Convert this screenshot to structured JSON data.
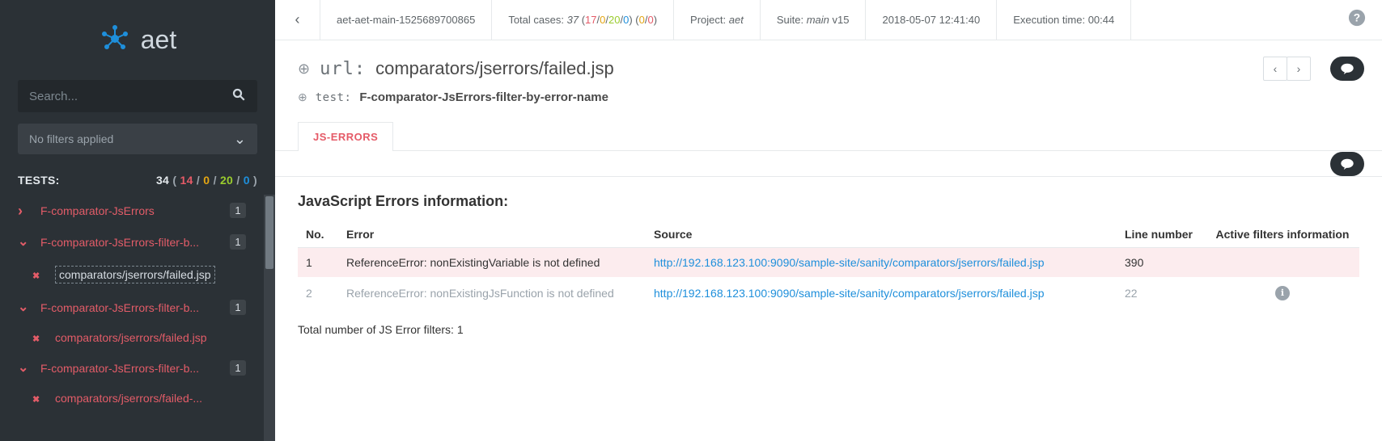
{
  "brand": {
    "name": "aet"
  },
  "sidebar": {
    "search_placeholder": "Search...",
    "filter_label": "No filters applied",
    "tests_label": "TESTS:",
    "tests_total": "34",
    "tests_fail": "14",
    "tests_warn": "0",
    "tests_pass": "20",
    "tests_skip": "0"
  },
  "test_items": [
    {
      "label": "F-comparator-JsErrors",
      "badge": "1",
      "expanded": false
    },
    {
      "label": "F-comparator-JsErrors-filter-b...",
      "badge": "1",
      "expanded": true,
      "child_label": "comparators/jserrors/failed.jsp",
      "child_selected": true
    },
    {
      "label": "F-comparator-JsErrors-filter-b...",
      "badge": "1",
      "expanded": true,
      "child_label": "comparators/jserrors/failed.jsp",
      "child_selected": false
    },
    {
      "label": "F-comparator-JsErrors-filter-b...",
      "badge": "1",
      "expanded": true,
      "child_label": "comparators/jserrors/failed-...",
      "child_selected": false
    }
  ],
  "topbar": {
    "run_name": "aet-aet-main-1525689700865",
    "total_label": "Total cases:",
    "total_val": "37",
    "total_fail": "17",
    "total_warn": "0",
    "total_pass": "20",
    "total_skip": "0",
    "total_extra_a": "0",
    "total_extra_b": "0",
    "project_label": "Project:",
    "project_val": "aet",
    "suite_label": "Suite:",
    "suite_val": "main",
    "suite_ver": "v15",
    "datetime": "2018-05-07 12:41:40",
    "exec_label": "Execution time:",
    "exec_val": "00:44"
  },
  "header": {
    "url_label": "url:",
    "url_value": "comparators/jserrors/failed.jsp",
    "test_label": "test:",
    "test_value": "F-comparator-JsErrors-filter-by-error-name"
  },
  "tabs": {
    "tab1": "JS-ERRORS"
  },
  "content": {
    "section_title": "JavaScript Errors information:",
    "col_no": "No.",
    "col_error": "Error",
    "col_source": "Source",
    "col_line": "Line number",
    "col_filters": "Active filters information",
    "rows": [
      {
        "no": "1",
        "error": "ReferenceError: nonExistingVariable is not defined",
        "source": "http://192.168.123.100:9090/sample-site/sanity/comparators/jserrors/failed.jsp",
        "line": "390",
        "filtered": false
      },
      {
        "no": "2",
        "error": "ReferenceError: nonExistingJsFunction is not defined",
        "source": "http://192.168.123.100:9090/sample-site/sanity/comparators/jserrors/failed.jsp",
        "line": "22",
        "filtered": true
      }
    ],
    "summary": "Total number of JS Error filters: 1"
  }
}
